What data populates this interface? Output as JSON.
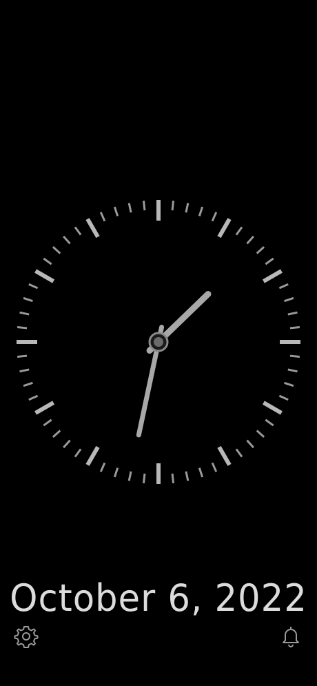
{
  "time": {
    "hour": 1,
    "minute": 32,
    "second": 0
  },
  "date_text": "October 6, 2022",
  "toolbar": {
    "settings_icon": "gear-icon",
    "alarm_icon": "bell-icon"
  },
  "colors": {
    "background": "#000000",
    "ticks": "#9a9a9a",
    "major_ticks": "#b8b8b8",
    "hands": "#a8a8a8",
    "date_text": "#dcdcdc"
  }
}
